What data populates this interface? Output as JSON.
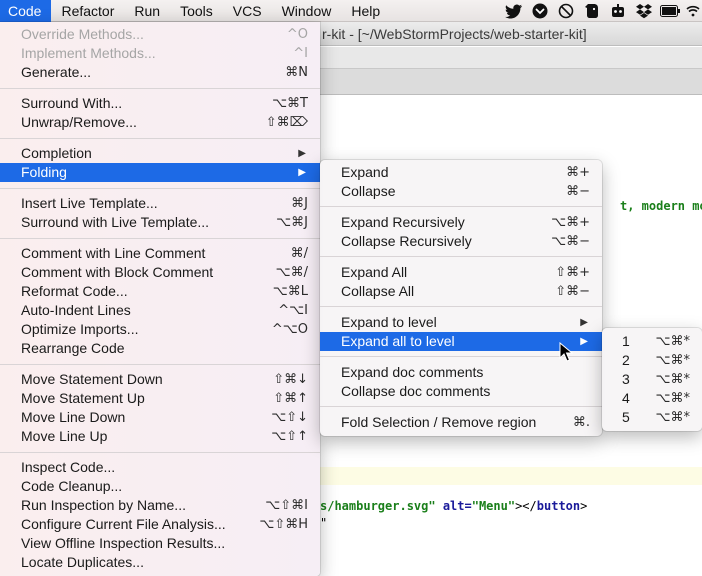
{
  "menubar": {
    "items": [
      "Code",
      "Refactor",
      "Run",
      "Tools",
      "VCS",
      "Window",
      "Help"
    ],
    "active": "Code",
    "status_icons": [
      "twitter-icon",
      "pocket-icon",
      "no-entry-icon",
      "evernote-icon",
      "bot-icon",
      "dropbox-icon",
      "battery-icon",
      "wifi-icon"
    ]
  },
  "window": {
    "title": "r-kit - [~/WebStormProjects/web-starter-kit]"
  },
  "editor": {
    "line1": "t, modern mobi",
    "line2_a": "s/hamburger.svg\"",
    "line2_b": " alt=",
    "line2_c": "\"Menu\"",
    "line2_d": "></",
    "line2_e": "button",
    "line2_f": ">",
    "line3": "\""
  },
  "code_menu": {
    "items": [
      {
        "label": "Override Methods...",
        "shortcut": "^O",
        "disabled": true
      },
      {
        "label": "Implement Methods...",
        "shortcut": "^I",
        "disabled": true
      },
      {
        "label": "Generate...",
        "shortcut": "⌘N"
      },
      {
        "label": "Surround With...",
        "shortcut": "⌥⌘T"
      },
      {
        "label": "Unwrap/Remove...",
        "shortcut": "⇧⌘⌦"
      },
      {
        "label": "Completion",
        "shortcut": ""
      },
      {
        "label": "Folding",
        "shortcut": ""
      },
      {
        "label": "Insert Live Template...",
        "shortcut": "⌘J"
      },
      {
        "label": "Surround with Live Template...",
        "shortcut": "⌥⌘J"
      },
      {
        "label": "Comment with Line Comment",
        "shortcut": "⌘/"
      },
      {
        "label": "Comment with Block Comment",
        "shortcut": "⌥⌘/"
      },
      {
        "label": "Reformat Code...",
        "shortcut": "⌥⌘L"
      },
      {
        "label": "Auto-Indent Lines",
        "shortcut": "^⌥I"
      },
      {
        "label": "Optimize Imports...",
        "shortcut": "^⌥O"
      },
      {
        "label": "Rearrange Code",
        "shortcut": ""
      },
      {
        "label": "Move Statement Down",
        "shortcut": "⇧⌘↓"
      },
      {
        "label": "Move Statement Up",
        "shortcut": "⇧⌘↑"
      },
      {
        "label": "Move Line Down",
        "shortcut": "⌥⇧↓"
      },
      {
        "label": "Move Line Up",
        "shortcut": "⌥⇧↑"
      },
      {
        "label": "Inspect Code...",
        "shortcut": ""
      },
      {
        "label": "Code Cleanup...",
        "shortcut": ""
      },
      {
        "label": "Run Inspection by Name...",
        "shortcut": "⌥⇧⌘I"
      },
      {
        "label": "Configure Current File Analysis...",
        "shortcut": "⌥⇧⌘H"
      },
      {
        "label": "View Offline Inspection Results...",
        "shortcut": ""
      },
      {
        "label": "Locate Duplicates...",
        "shortcut": ""
      }
    ]
  },
  "folding_menu": {
    "items": [
      {
        "label": "Expand",
        "shortcut": "⌘+"
      },
      {
        "label": "Collapse",
        "shortcut": "⌘−"
      },
      {
        "label": "Expand Recursively",
        "shortcut": "⌥⌘+"
      },
      {
        "label": "Collapse Recursively",
        "shortcut": "⌥⌘−"
      },
      {
        "label": "Expand All",
        "shortcut": "⇧⌘+"
      },
      {
        "label": "Collapse All",
        "shortcut": "⇧⌘−"
      },
      {
        "label": "Expand to level",
        "shortcut": ""
      },
      {
        "label": "Expand all to level",
        "shortcut": ""
      },
      {
        "label": "Expand doc comments",
        "shortcut": ""
      },
      {
        "label": "Collapse doc comments",
        "shortcut": ""
      },
      {
        "label": "Fold Selection / Remove region",
        "shortcut": "⌘."
      }
    ]
  },
  "level_menu": {
    "items": [
      {
        "label": "1",
        "shortcut": "⌥⌘*"
      },
      {
        "label": "2",
        "shortcut": "⌥⌘*"
      },
      {
        "label": "3",
        "shortcut": "⌥⌘*"
      },
      {
        "label": "4",
        "shortcut": "⌥⌘*"
      },
      {
        "label": "5",
        "shortcut": "⌥⌘*"
      }
    ]
  },
  "colors": {
    "selection": "#1d6ae6",
    "code_string_green": "#1a7f1a",
    "code_attr_navy": "#1a1a9a"
  }
}
